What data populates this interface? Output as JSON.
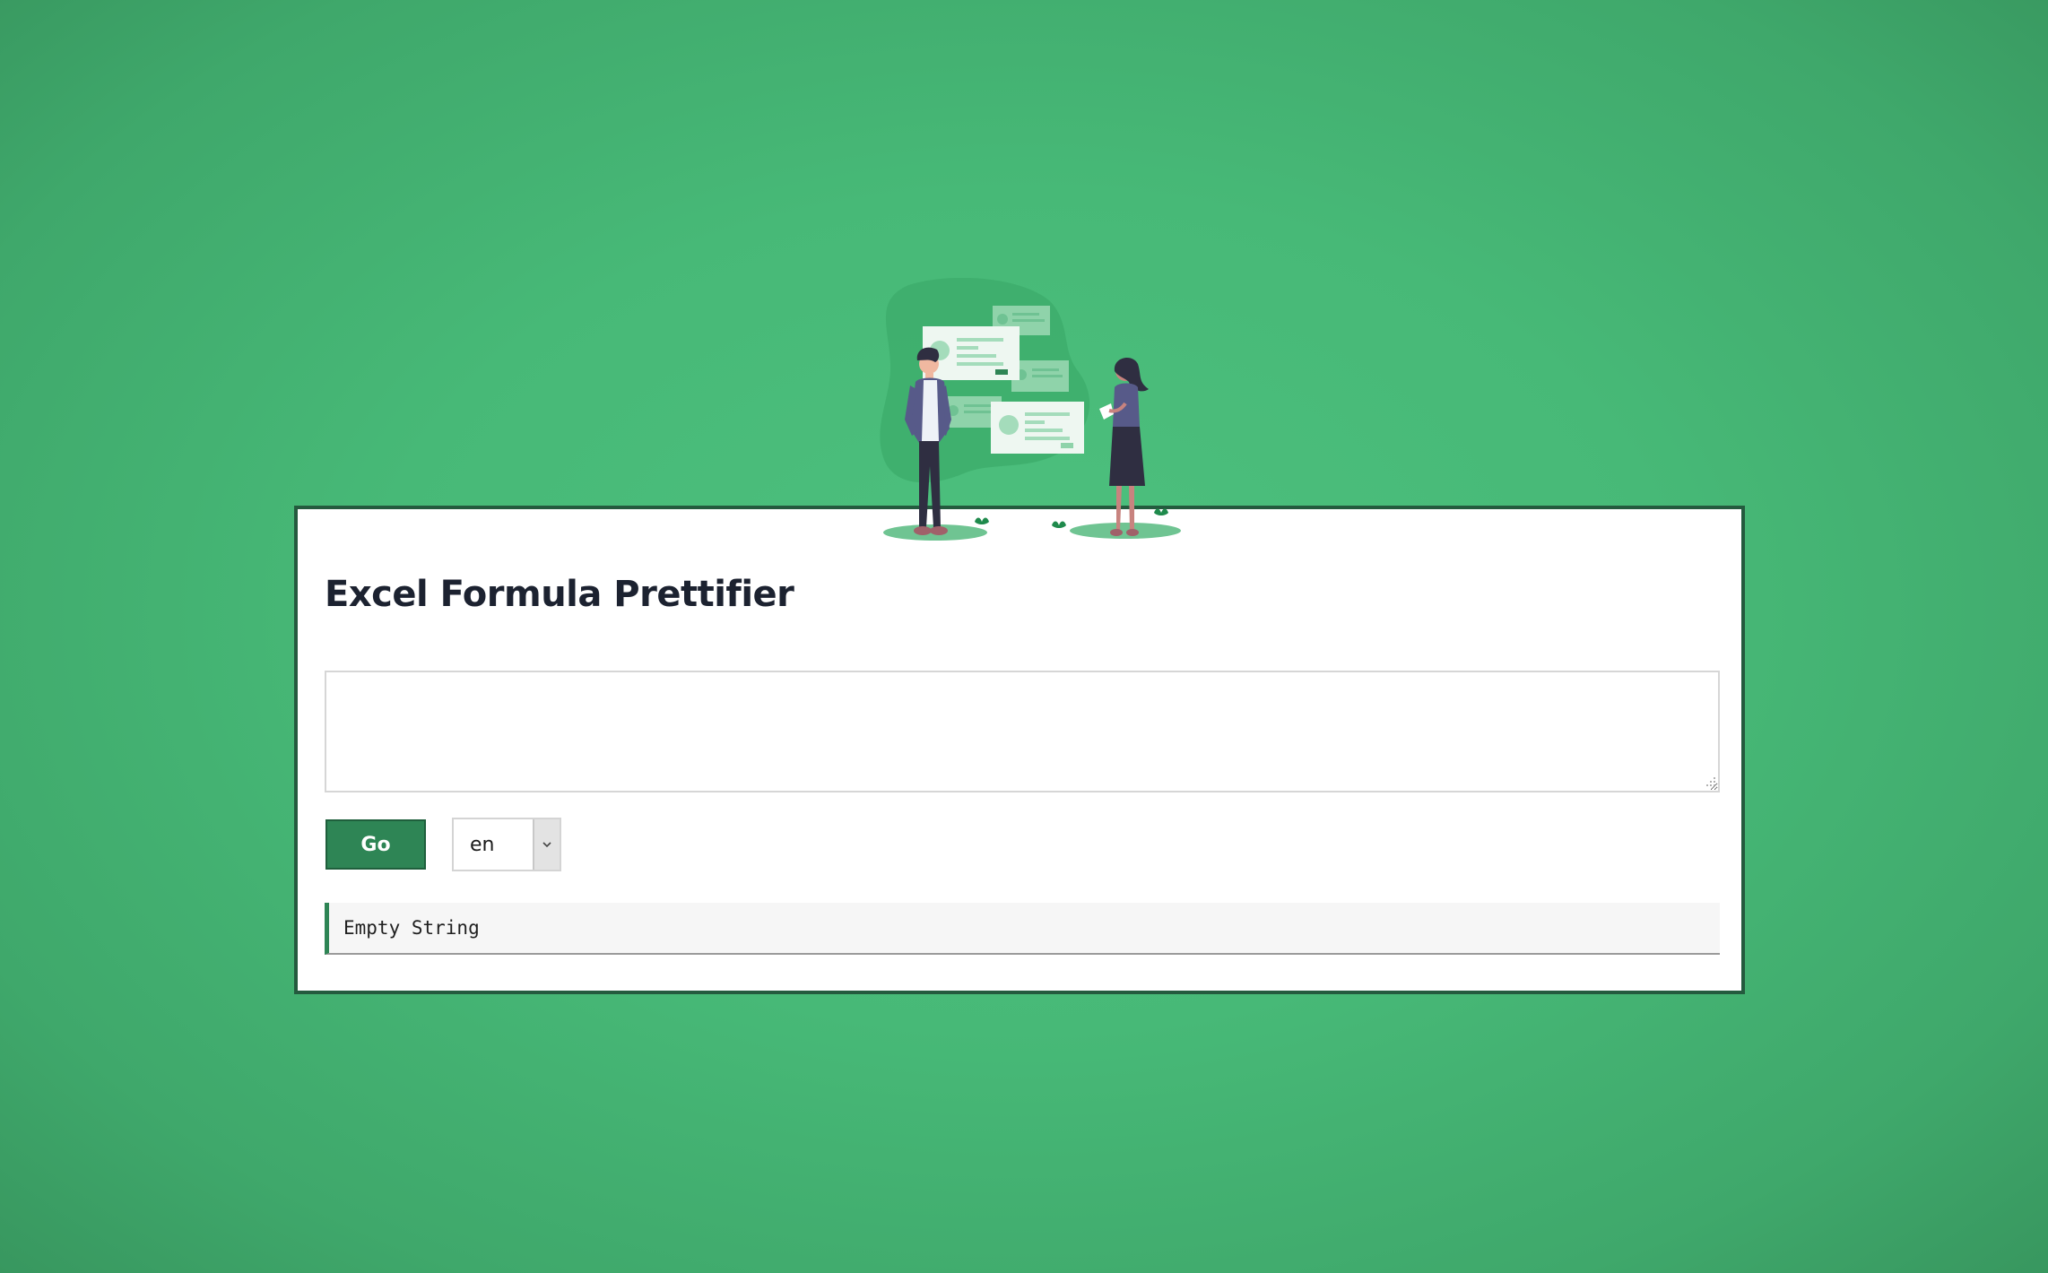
{
  "app": {
    "title": "Excel Formula Prettifier"
  },
  "input": {
    "value": "",
    "placeholder": ""
  },
  "controls": {
    "go_label": "Go",
    "language": {
      "selected": "en"
    }
  },
  "output": {
    "text": "Empty String"
  },
  "icons": {
    "dropdown": "chevron-down-icon",
    "resize": "resize-grip-icon",
    "illustration": "people-with-message-cards-illustration"
  },
  "colors": {
    "background": "#47b977",
    "accent": "#2e8555",
    "card_border": "#245a3e",
    "title": "#1c2230"
  }
}
